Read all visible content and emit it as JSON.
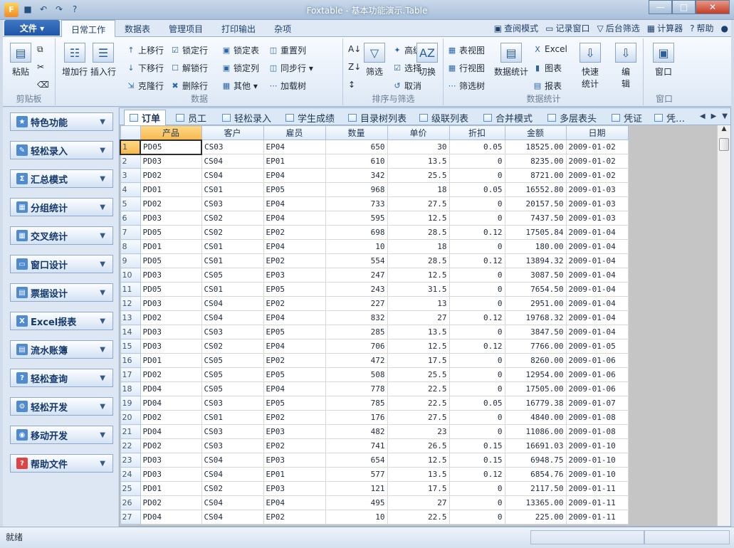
{
  "window": {
    "title": "Foxtable - 基本功能演示.Table",
    "buttons": {
      "minimize": "—",
      "maximize": "□",
      "close": "✕"
    }
  },
  "ribbon_tabs": {
    "file": "文件 ▾",
    "items": [
      "日常工作",
      "数据表",
      "管理项目",
      "打印输出",
      "杂项"
    ]
  },
  "top_right_tools": [
    "查阅模式",
    "记录窗口",
    "后台筛选",
    "计算器",
    "帮助"
  ],
  "ribbon": {
    "groups": [
      "剪贴板",
      "数据",
      "排序与筛选",
      "数据统计",
      "窗口"
    ],
    "clipboard": {
      "paste": "粘贴"
    },
    "data": {
      "add_row": "增加行",
      "insert_row": "插入行",
      "move_up": "上移行",
      "move_down": "下移行",
      "clone_row": "克隆行",
      "lock_row": "锁定行",
      "unlock_row": "解锁行",
      "delete_row": "删除行",
      "lock_table": "锁定表",
      "lock_col": "锁定列",
      "other": "其他 ▾",
      "reset_col": "重置列",
      "sync_row": "同步行 ▾",
      "load_tree": "加载树"
    },
    "sort": {
      "filter": "筛选",
      "advanced": "高级",
      "select": "选择",
      "cancel": "取消",
      "toggle": "切换"
    },
    "stats": {
      "table_view": "表视图",
      "row_view": "行视图",
      "filter_tree": "筛选树",
      "data_stats": "数据统计",
      "excel": "Excel",
      "chart": "图表",
      "report": "报表",
      "quick_stats": "快速\n统计",
      "edit": "编\n辑"
    },
    "window": {
      "window": "窗口"
    }
  },
  "sidebar": {
    "items": [
      "特色功能",
      "轻松录入",
      "汇总模式",
      "分组统计",
      "交叉统计",
      "窗口设计",
      "票据设计",
      "Excel报表",
      "流水账簿",
      "轻松查询",
      "轻松开发",
      "移动开发",
      "帮助文件"
    ]
  },
  "table_tabs": [
    "订单",
    "员工",
    "轻松录入",
    "学生成绩",
    "目录树列表",
    "级联列表",
    "合并模式",
    "多层表头",
    "凭证",
    "凭…"
  ],
  "table": {
    "columns": [
      "产品",
      "客户",
      "雇员",
      "数量",
      "单价",
      "折扣",
      "金额",
      "日期"
    ],
    "rows": [
      [
        "1",
        "PD05",
        "CS03",
        "EP04",
        "650",
        "30",
        "0.05",
        "18525.00",
        "2009-01-02"
      ],
      [
        "2",
        "PD03",
        "CS04",
        "EP01",
        "610",
        "13.5",
        "0",
        "8235.00",
        "2009-01-02"
      ],
      [
        "3",
        "PD02",
        "CS04",
        "EP04",
        "342",
        "25.5",
        "0",
        "8721.00",
        "2009-01-02"
      ],
      [
        "4",
        "PD01",
        "CS01",
        "EP05",
        "968",
        "18",
        "0.05",
        "16552.80",
        "2009-01-03"
      ],
      [
        "5",
        "PD02",
        "CS03",
        "EP04",
        "733",
        "27.5",
        "0",
        "20157.50",
        "2009-01-03"
      ],
      [
        "6",
        "PD03",
        "CS02",
        "EP04",
        "595",
        "12.5",
        "0",
        "7437.50",
        "2009-01-03"
      ],
      [
        "7",
        "PD05",
        "CS02",
        "EP02",
        "698",
        "28.5",
        "0.12",
        "17505.84",
        "2009-01-04"
      ],
      [
        "8",
        "PD01",
        "CS01",
        "EP04",
        "10",
        "18",
        "0",
        "180.00",
        "2009-01-04"
      ],
      [
        "9",
        "PD05",
        "CS01",
        "EP02",
        "554",
        "28.5",
        "0.12",
        "13894.32",
        "2009-01-04"
      ],
      [
        "10",
        "PD03",
        "CS05",
        "EP03",
        "247",
        "12.5",
        "0",
        "3087.50",
        "2009-01-04"
      ],
      [
        "11",
        "PD05",
        "CS01",
        "EP05",
        "243",
        "31.5",
        "0",
        "7654.50",
        "2009-01-04"
      ],
      [
        "12",
        "PD03",
        "CS04",
        "EP02",
        "227",
        "13",
        "0",
        "2951.00",
        "2009-01-04"
      ],
      [
        "13",
        "PD02",
        "CS04",
        "EP04",
        "832",
        "27",
        "0.12",
        "19768.32",
        "2009-01-04"
      ],
      [
        "14",
        "PD03",
        "CS03",
        "EP05",
        "285",
        "13.5",
        "0",
        "3847.50",
        "2009-01-04"
      ],
      [
        "15",
        "PD03",
        "CS02",
        "EP04",
        "706",
        "12.5",
        "0.12",
        "7766.00",
        "2009-01-05"
      ],
      [
        "16",
        "PD01",
        "CS05",
        "EP02",
        "472",
        "17.5",
        "0",
        "8260.00",
        "2009-01-06"
      ],
      [
        "17",
        "PD02",
        "CS05",
        "EP05",
        "508",
        "25.5",
        "0",
        "12954.00",
        "2009-01-06"
      ],
      [
        "18",
        "PD04",
        "CS05",
        "EP04",
        "778",
        "22.5",
        "0",
        "17505.00",
        "2009-01-06"
      ],
      [
        "19",
        "PD04",
        "CS03",
        "EP05",
        "785",
        "22.5",
        "0.05",
        "16779.38",
        "2009-01-07"
      ],
      [
        "20",
        "PD02",
        "CS01",
        "EP02",
        "176",
        "27.5",
        "0",
        "4840.00",
        "2009-01-08"
      ],
      [
        "21",
        "PD04",
        "CS03",
        "EP03",
        "482",
        "23",
        "0",
        "11086.00",
        "2009-01-08"
      ],
      [
        "22",
        "PD02",
        "CS03",
        "EP02",
        "741",
        "26.5",
        "0.15",
        "16691.03",
        "2009-01-10"
      ],
      [
        "23",
        "PD03",
        "CS04",
        "EP03",
        "654",
        "12.5",
        "0.15",
        "6948.75",
        "2009-01-10"
      ],
      [
        "24",
        "PD03",
        "CS04",
        "EP01",
        "577",
        "13.5",
        "0.12",
        "6854.76",
        "2009-01-10"
      ],
      [
        "25",
        "PD01",
        "CS02",
        "EP03",
        "121",
        "17.5",
        "0",
        "2117.50",
        "2009-01-11"
      ],
      [
        "26",
        "PD02",
        "CS04",
        "EP04",
        "495",
        "27",
        "0",
        "13365.00",
        "2009-01-11"
      ],
      [
        "27",
        "PD04",
        "CS04",
        "EP02",
        "10",
        "22.5",
        "0",
        "225.00",
        "2009-01-11"
      ]
    ]
  },
  "status": {
    "text": "就绪"
  }
}
